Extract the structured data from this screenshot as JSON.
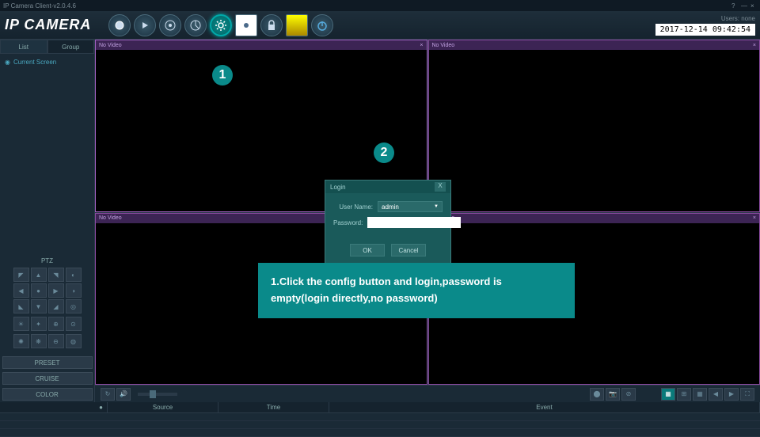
{
  "titlebar": {
    "title": "IP Camera Client-v2.0.4.6",
    "help": "?",
    "min": "—",
    "close": "×"
  },
  "header": {
    "logo": "IP CAMERA",
    "users_label": "Users: none",
    "datetime": "2017-12-14 09:42:54"
  },
  "sidebar": {
    "tabs": {
      "list": "List",
      "group": "Group"
    },
    "tree_item": "Current Screen",
    "ptz": {
      "label": "PTZ"
    },
    "buttons": {
      "preset": "PRESET",
      "cruise": "CRUISE",
      "color": "COLOR"
    }
  },
  "video": {
    "no_video": "No Video",
    "close": "×"
  },
  "log": {
    "cols": {
      "source": "Source",
      "time": "Time",
      "event": "Event"
    }
  },
  "login": {
    "title": "Login",
    "close": "X",
    "username_label": "User Name:",
    "username_value": "admin",
    "password_label": "Password:",
    "ok": "OK",
    "cancel": "Cancel"
  },
  "markers": {
    "m1": "1",
    "m2": "2"
  },
  "instruction": "1.Click the config button and login,password is empty(login directly,no password)"
}
